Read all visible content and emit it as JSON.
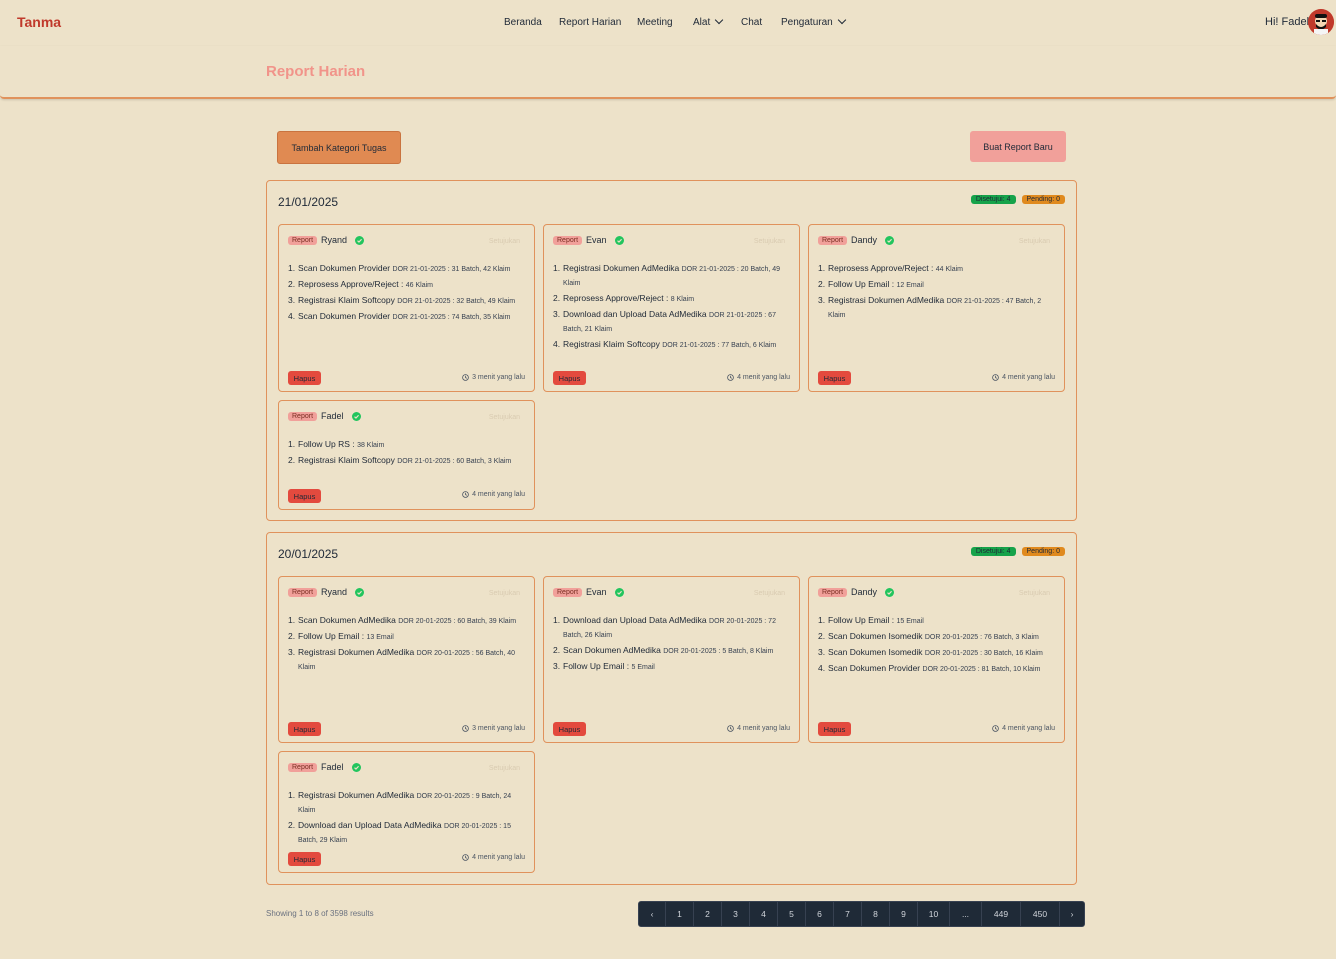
{
  "nav": {
    "brand": "Tanma",
    "menu": [
      "Beranda",
      "Report Harian",
      "Meeting",
      "Alat",
      "Chat",
      "Pengaturan"
    ],
    "greeting": "Hi! Fadel"
  },
  "page": {
    "title": "Report Harian",
    "add_category_label": "Tambah Kategori Tugas",
    "new_report_label": "Buat Report Baru"
  },
  "groups": [
    {
      "date": "21/01/2025",
      "approved": "Disetujui: 4",
      "pending": "Pending: 0",
      "cards": [
        {
          "tag": "Report",
          "name": "Ryand",
          "ghost": "Setujukan",
          "tasks": [
            {
              "t": "Scan Dokumen Provider",
              "d": "DOR 21-01-2025 : 31 Batch, 42 Klaim"
            },
            {
              "t": "Reprosess Approve/Reject :",
              "d": "46 Klaim"
            },
            {
              "t": "Registrasi Klaim Softcopy",
              "d": "DOR 21-01-2025 : 32 Batch, 49 Klaim"
            },
            {
              "t": "Scan Dokumen Provider",
              "d": "DOR 21-01-2025 : 74 Batch, 35 Klaim"
            }
          ],
          "delete": "Hapus",
          "time": "3 menit yang lalu"
        },
        {
          "tag": "Report",
          "name": "Evan",
          "ghost": "Setujukan",
          "tasks": [
            {
              "t": "Registrasi Dokumen AdMedika",
              "d": "DOR 21-01-2025 : 20 Batch, 49 Klaim"
            },
            {
              "t": "Reprosess Approve/Reject :",
              "d": "8 Klaim"
            },
            {
              "t": "Download dan Upload Data AdMedika",
              "d": "DOR 21-01-2025 : 67 Batch, 21 Klaim"
            },
            {
              "t": "Registrasi Klaim Softcopy",
              "d": "DOR 21-01-2025 : 77 Batch, 6 Klaim"
            }
          ],
          "delete": "Hapus",
          "time": "4 menit yang lalu"
        },
        {
          "tag": "Report",
          "name": "Dandy",
          "ghost": "Setujukan",
          "tasks": [
            {
              "t": "Reprosess Approve/Reject :",
              "d": "44 Klaim"
            },
            {
              "t": "Follow Up Email :",
              "d": "12 Email"
            },
            {
              "t": "Registrasi Dokumen AdMedika",
              "d": "DOR 21-01-2025 : 47 Batch, 2 Klaim"
            }
          ],
          "delete": "Hapus",
          "time": "4 menit yang lalu"
        },
        {
          "tag": "Report",
          "name": "Fadel",
          "ghost": "Setujukan",
          "tasks": [
            {
              "t": "Follow Up RS :",
              "d": "38 Klaim"
            },
            {
              "t": "Registrasi Klaim Softcopy",
              "d": "DOR 21-01-2025 : 60 Batch, 3 Klaim"
            }
          ],
          "delete": "Hapus",
          "time": "4 menit yang lalu"
        }
      ]
    },
    {
      "date": "20/01/2025",
      "approved": "Disetujui: 4",
      "pending": "Pending: 0",
      "cards": [
        {
          "tag": "Report",
          "name": "Ryand",
          "ghost": "Setujukan",
          "tasks": [
            {
              "t": "Scan Dokumen AdMedika",
              "d": "DOR 20-01-2025 : 60 Batch, 39 Klaim"
            },
            {
              "t": "Follow Up Email :",
              "d": "13 Email"
            },
            {
              "t": "Registrasi Dokumen AdMedika",
              "d": "DOR 20-01-2025 : 56 Batch, 40 Klaim"
            }
          ],
          "delete": "Hapus",
          "time": "3 menit yang lalu"
        },
        {
          "tag": "Report",
          "name": "Evan",
          "ghost": "Setujukan",
          "tasks": [
            {
              "t": "Download dan Upload Data AdMedika",
              "d": "DOR 20-01-2025 : 72 Batch, 26 Klaim"
            },
            {
              "t": "Scan Dokumen AdMedika",
              "d": "DOR 20-01-2025 : 5 Batch, 8 Klaim"
            },
            {
              "t": "Follow Up Email :",
              "d": "5 Email"
            }
          ],
          "delete": "Hapus",
          "time": "4 menit yang lalu"
        },
        {
          "tag": "Report",
          "name": "Dandy",
          "ghost": "Setujukan",
          "tasks": [
            {
              "t": "Follow Up Email :",
              "d": "15 Email"
            },
            {
              "t": "Scan Dokumen Isomedik",
              "d": "DOR 20-01-2025 : 76 Batch, 3 Klaim"
            },
            {
              "t": "Scan Dokumen Isomedik",
              "d": "DOR 20-01-2025 : 30 Batch, 16 Klaim"
            },
            {
              "t": "Scan Dokumen Provider",
              "d": "DOR 20-01-2025 : 81 Batch, 10 Klaim"
            }
          ],
          "delete": "Hapus",
          "time": "4 menit yang lalu"
        },
        {
          "tag": "Report",
          "name": "Fadel",
          "ghost": "Setujukan",
          "tasks": [
            {
              "t": "Registrasi Dokumen AdMedika",
              "d": "DOR 20-01-2025 : 9 Batch, 24 Klaim"
            },
            {
              "t": "Download dan Upload Data AdMedika",
              "d": "DOR 20-01-2025 : 15 Batch, 29 Klaim"
            }
          ],
          "delete": "Hapus",
          "time": "4 menit yang lalu"
        }
      ]
    }
  ],
  "pagination": {
    "results": "Showing 1 to 8 of 3598 results",
    "pages": [
      "‹",
      "1",
      "2",
      "3",
      "4",
      "5",
      "6",
      "7",
      "8",
      "9",
      "10",
      "...",
      "449",
      "450",
      "›"
    ],
    "colors": {
      "bg": "#1f2a37",
      "text": "#d1d5db"
    }
  },
  "colors": {
    "accent": "#e0925c",
    "brand": "#c0392b",
    "delete": "#e34a3e",
    "approved": "#16a34a",
    "pending": "#e08a1e"
  }
}
